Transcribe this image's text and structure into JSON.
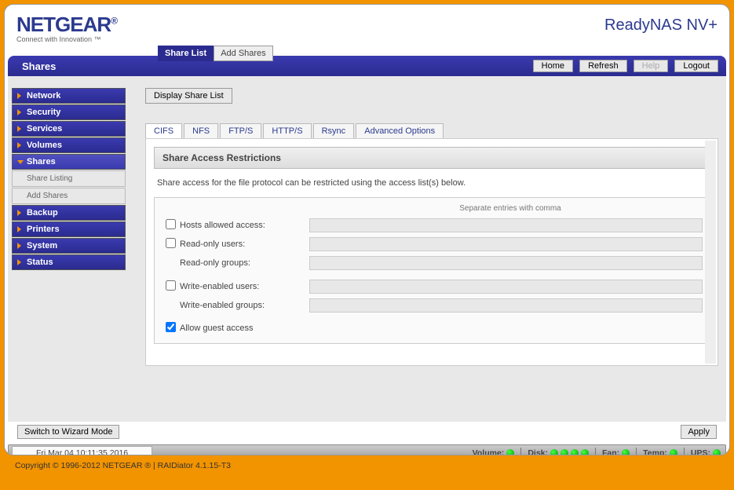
{
  "logo": {
    "brand": "NETGEAR",
    "reg": "®",
    "tagline": "Connect with Innovation ™"
  },
  "product_name": "ReadyNAS NV+",
  "top_tabs": {
    "active": "Share List",
    "other": "Add Shares"
  },
  "page_title": "Shares",
  "toolbar": {
    "home": "Home",
    "refresh": "Refresh",
    "help": "Help",
    "logout": "Logout"
  },
  "sidebar": {
    "items": [
      "Network",
      "Security",
      "Services",
      "Volumes",
      "Shares"
    ],
    "sub": [
      "Share Listing",
      "Add Shares"
    ],
    "items2": [
      "Backup",
      "Printers",
      "System",
      "Status"
    ]
  },
  "content": {
    "display_btn": "Display Share List",
    "tabs": [
      "CIFS",
      "NFS",
      "FTP/S",
      "HTTP/S",
      "Rsync",
      "Advanced Options"
    ],
    "panel_title": "Share Access Restrictions",
    "panel_desc": "Share access for the file protocol can be restricted using the access list(s) below.",
    "hint": "Separate entries with comma",
    "rows": {
      "hosts": "Hosts allowed access:",
      "ro_users": "Read-only users:",
      "ro_groups": "Read-only groups:",
      "we_users": "Write-enabled users:",
      "we_groups": "Write-enabled groups:",
      "guest": "Allow guest access"
    }
  },
  "bottom": {
    "wizard": "Switch to Wizard Mode",
    "apply": "Apply"
  },
  "status": {
    "time": "Fri Mar 04  10:11:35 2016",
    "volume": "Volume:",
    "disk": "Disk:",
    "fan": "Fan:",
    "temp": "Temp:",
    "ups": "UPS:"
  },
  "copyright": "Copyright © 1996-2012 NETGEAR ® | RAIDiator 4.1.15-T3"
}
